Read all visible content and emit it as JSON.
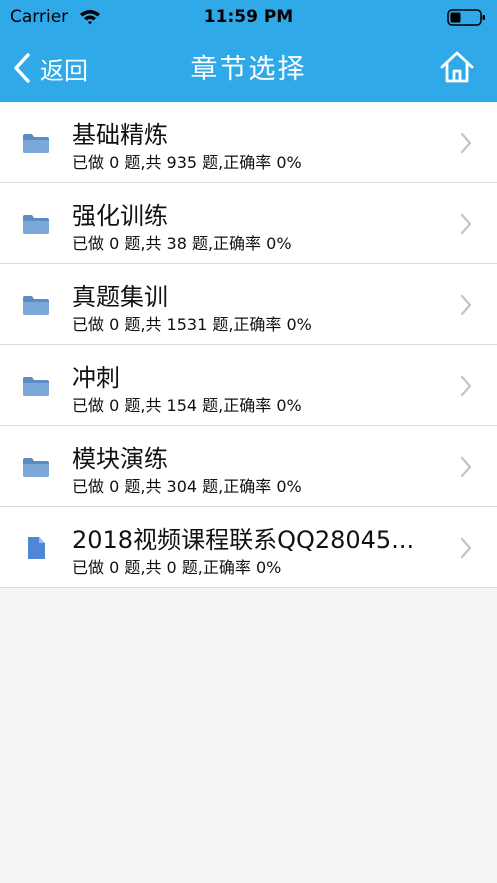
{
  "status_bar": {
    "carrier": "Carrier",
    "time": "11:59 PM"
  },
  "nav": {
    "back_label": "返回",
    "title": "章节选择",
    "home_icon": "home-icon"
  },
  "chapters": [
    {
      "title": "基础精炼",
      "stats": "已做 0 题,共 935 题,正确率 0%",
      "icon": "folder-icon"
    },
    {
      "title": "强化训练",
      "stats": "已做 0 题,共 38 题,正确率 0%",
      "icon": "folder-icon"
    },
    {
      "title": "真题集训",
      "stats": "已做 0 题,共 1531 题,正确率 0%",
      "icon": "folder-icon"
    },
    {
      "title": "冲刺",
      "stats": "已做 0 题,共 154 题,正确率 0%",
      "icon": "folder-icon"
    },
    {
      "title": "模块演练",
      "stats": "已做 0 题,共 304 题,正确率 0%",
      "icon": "folder-icon"
    },
    {
      "title": "2018视频课程联系QQ28045...",
      "stats": "已做 0 题,共 0 题,正确率 0%",
      "icon": "document-icon"
    }
  ],
  "colors": {
    "header": "#2fa9e8",
    "background": "#f4f4f4",
    "folder": "#6f9fd0",
    "chevron": "#c4c4c4"
  }
}
